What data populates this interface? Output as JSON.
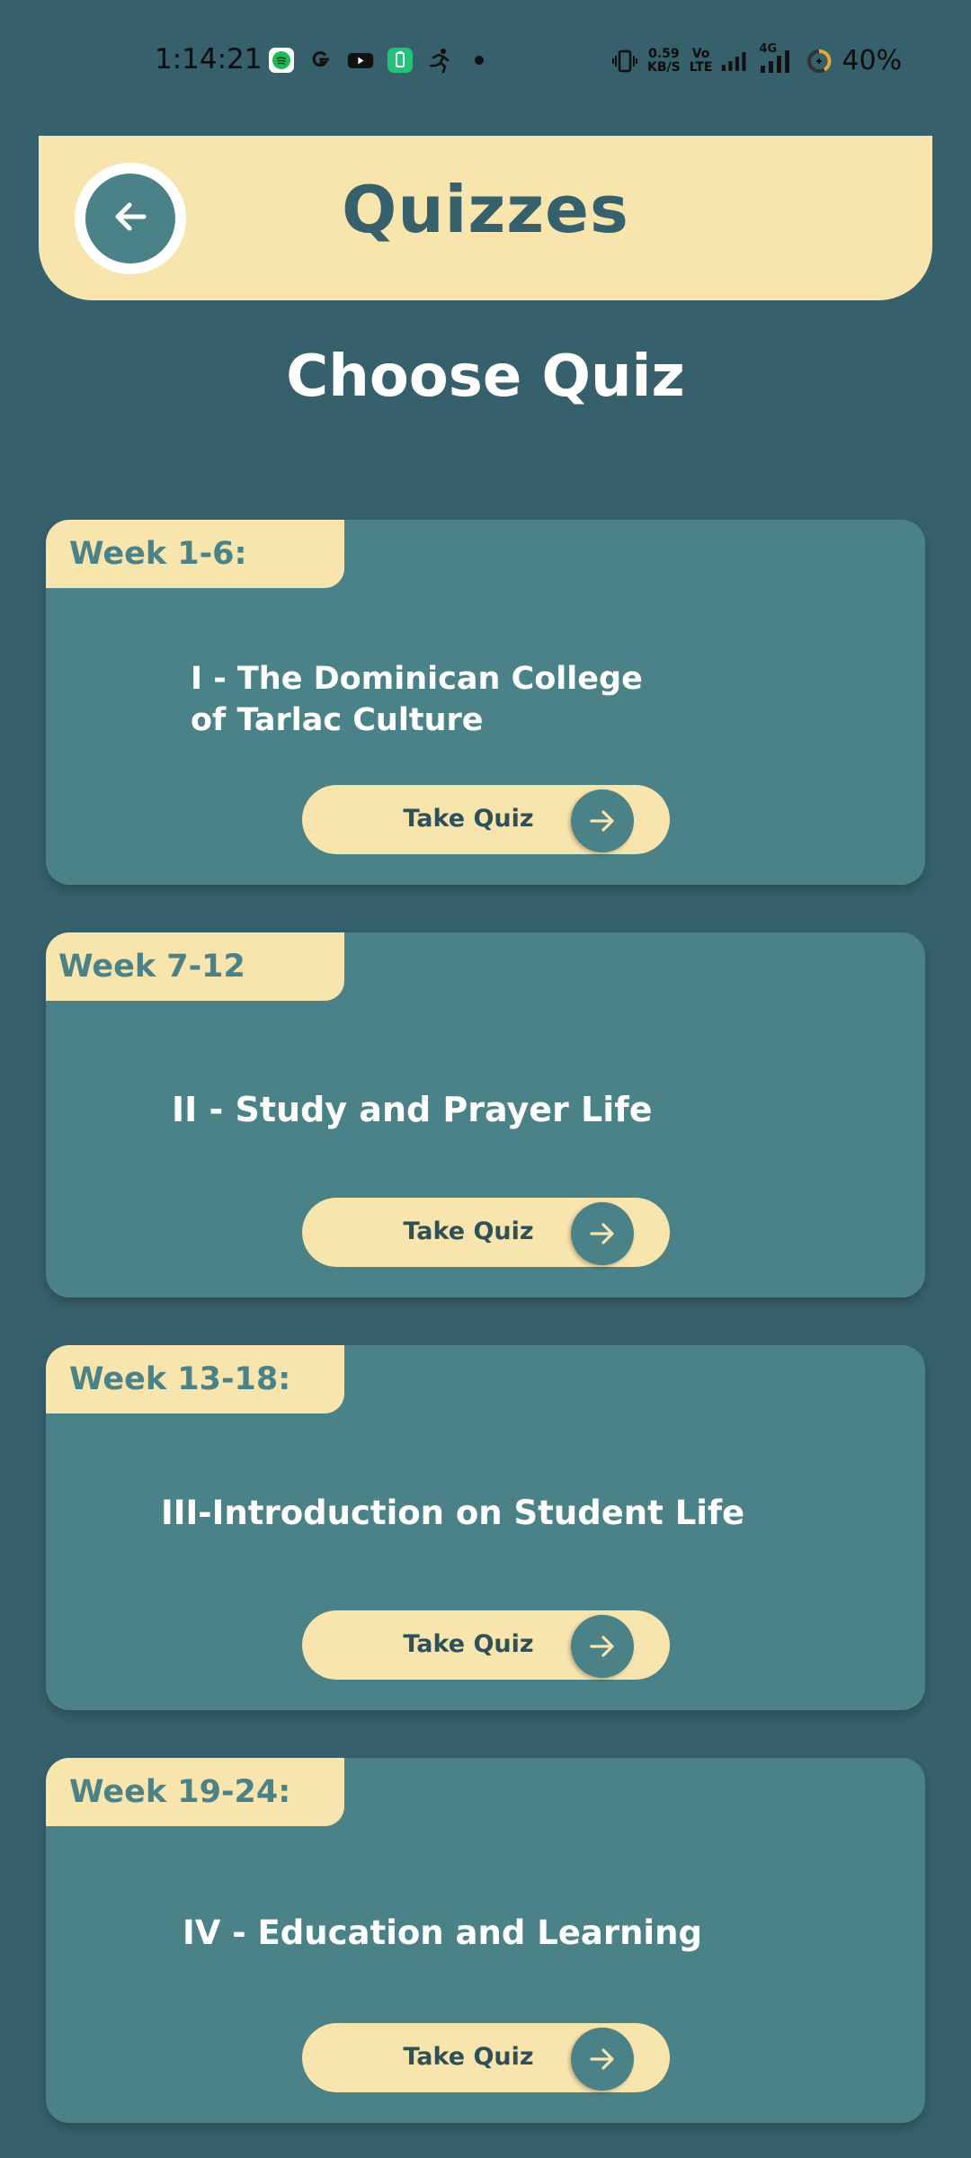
{
  "status_bar": {
    "time": "1:14:21",
    "net_speed_value": "0.59",
    "net_speed_unit": "KB/S",
    "volte_top": "Vo",
    "volte_bottom": "LTE",
    "network_type": "4G",
    "battery_percent": "40%"
  },
  "header": {
    "title": "Quizzes",
    "back_icon": "arrow-left-icon"
  },
  "page_title": "Choose Quiz",
  "quizzes": [
    {
      "week": "Week 1-6:",
      "title_line1": "I - The Dominican College",
      "title_line2": "of Tarlac Culture",
      "button_label": "Take Quiz"
    },
    {
      "week": "Week 7-12",
      "title_line1": "II - Study and Prayer Life",
      "title_line2": "",
      "button_label": "Take Quiz"
    },
    {
      "week": "Week 13-18:",
      "title_line1": "III-Introduction on Student Life",
      "title_line2": "",
      "button_label": "Take Quiz"
    },
    {
      "week": "Week 19-24:",
      "title_line1": "IV - Education and Learning",
      "title_line2": "",
      "button_label": "Take Quiz"
    }
  ],
  "colors": {
    "background": "#36606b",
    "card": "#4a8287",
    "accent": "#f8e4ad",
    "text_light": "#ffffff"
  }
}
